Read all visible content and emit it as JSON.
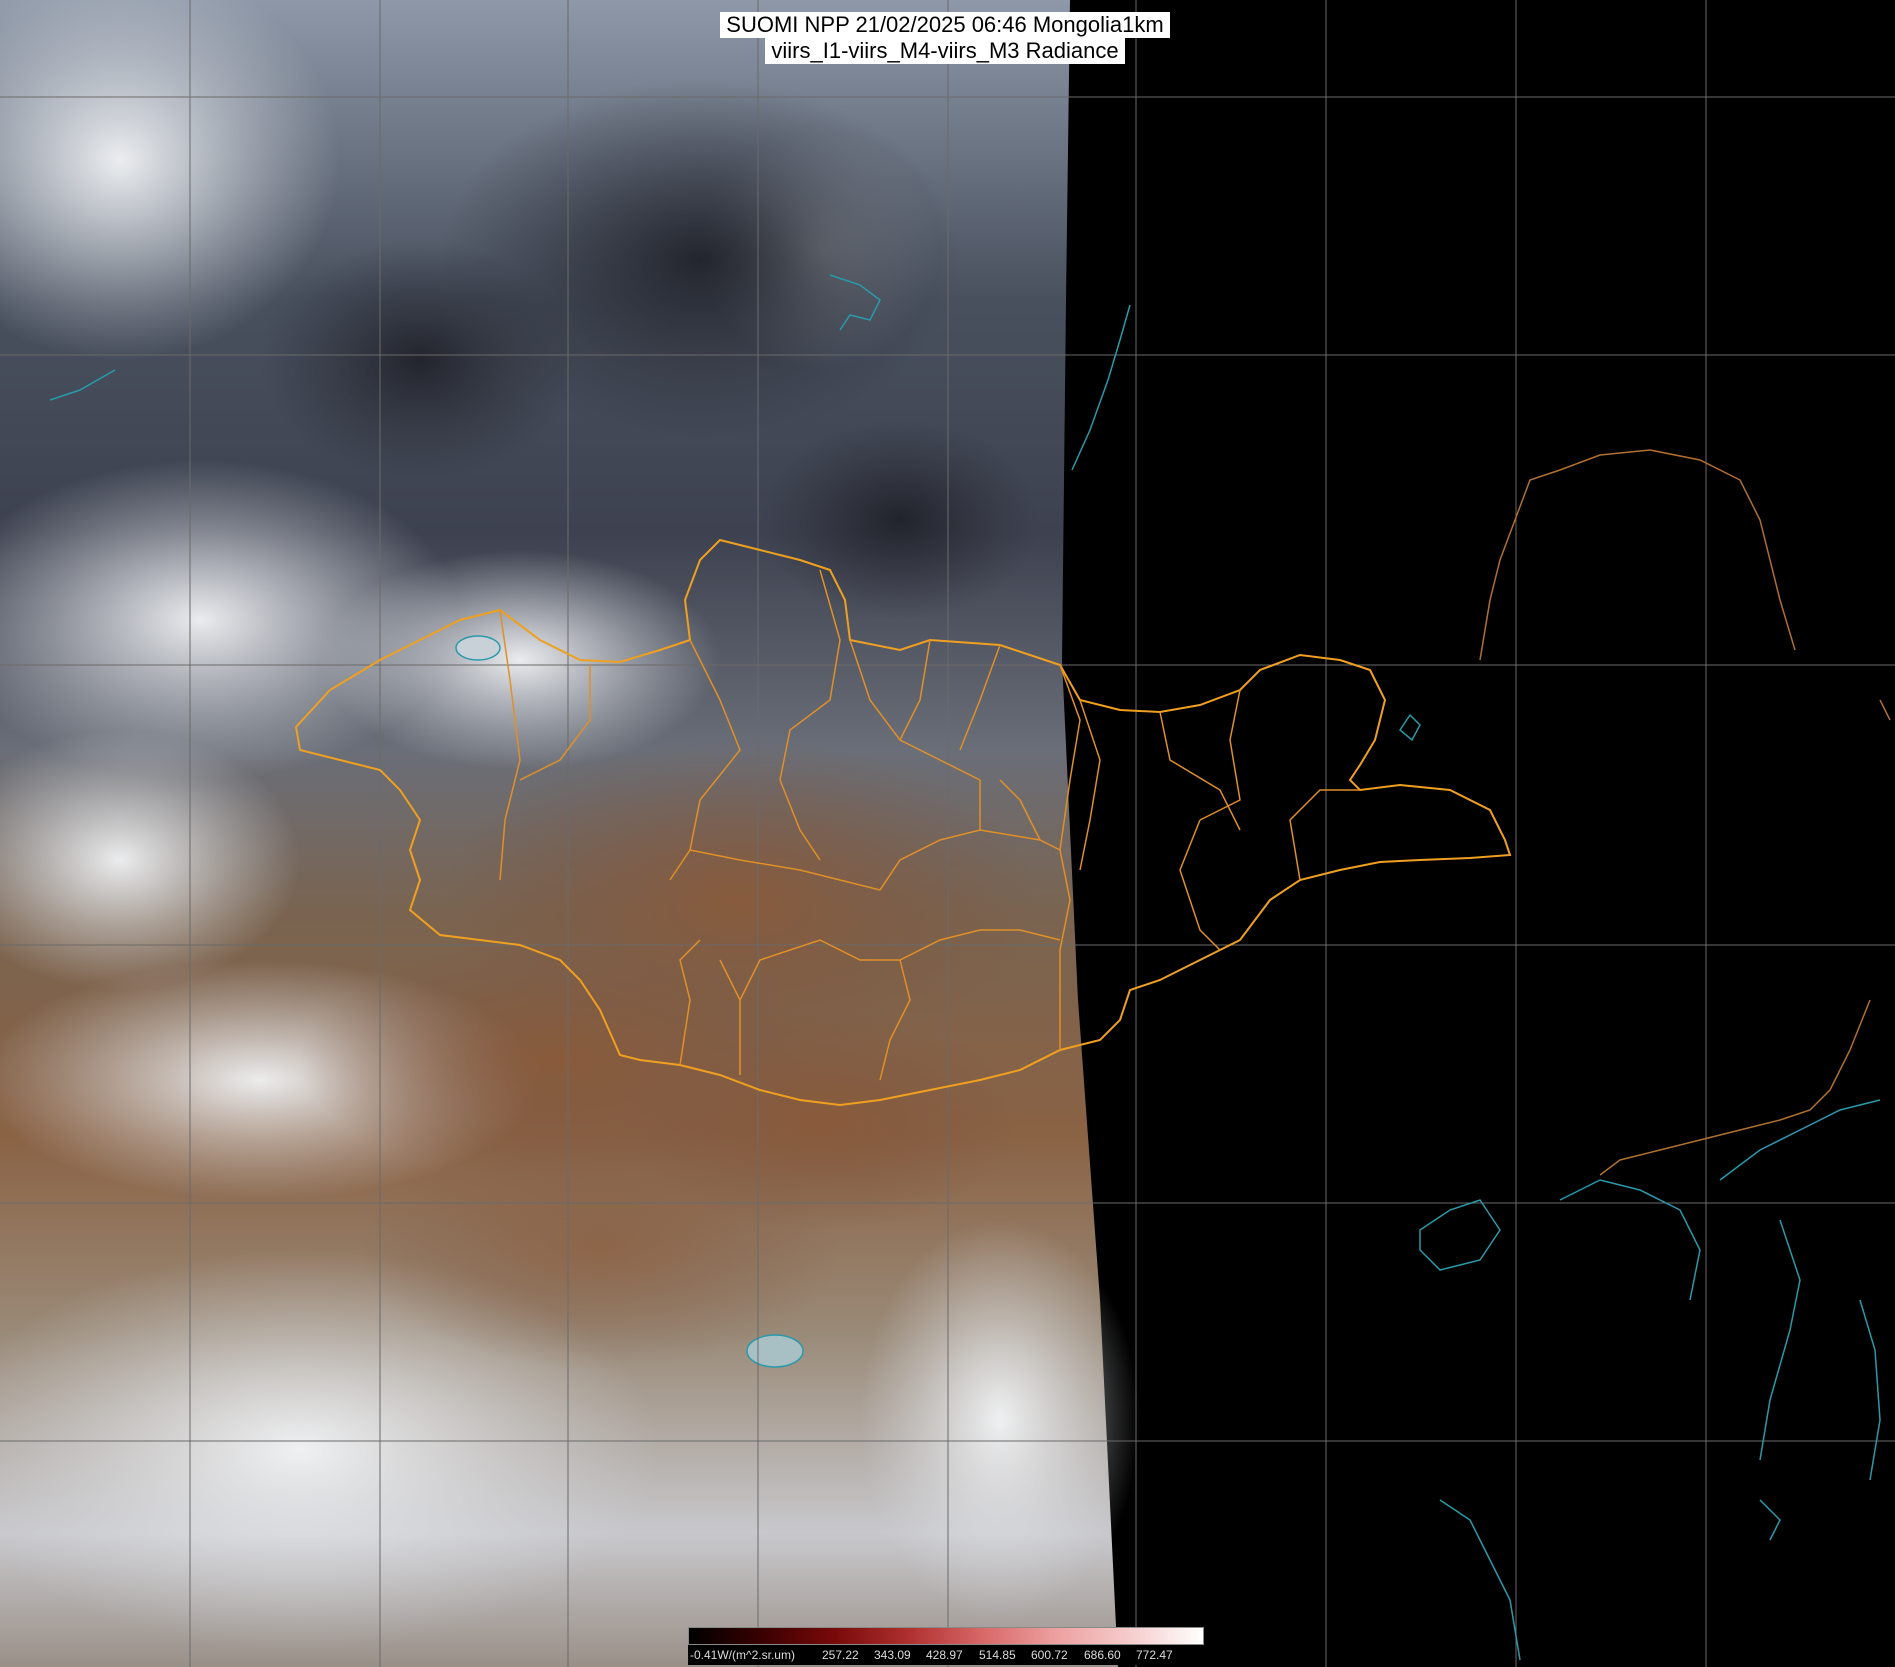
{
  "title": {
    "line1": "SUOMI NPP 21/02/2025 06:46 Mongolia1km",
    "line2": "viirs_I1-viirs_M4-viirs_M3 Radiance"
  },
  "legend": {
    "unit_label": "-0.41W/(m^2.sr.um)",
    "ticks": [
      "257.22",
      "343.09",
      "428.97",
      "514.85",
      "600.72",
      "686.60",
      "772.47"
    ],
    "colors": [
      "#000000",
      "#3a0000",
      "#7a0a0a",
      "#b03030",
      "#d86868",
      "#eda0a0",
      "#f6cccc",
      "#ffffff"
    ]
  },
  "colors": {
    "border_country": "#f0a020",
    "border_province": "#e09028",
    "coastline": "#2a9aaa",
    "graticule": "#6a6a6a",
    "night_side": "#000000"
  }
}
